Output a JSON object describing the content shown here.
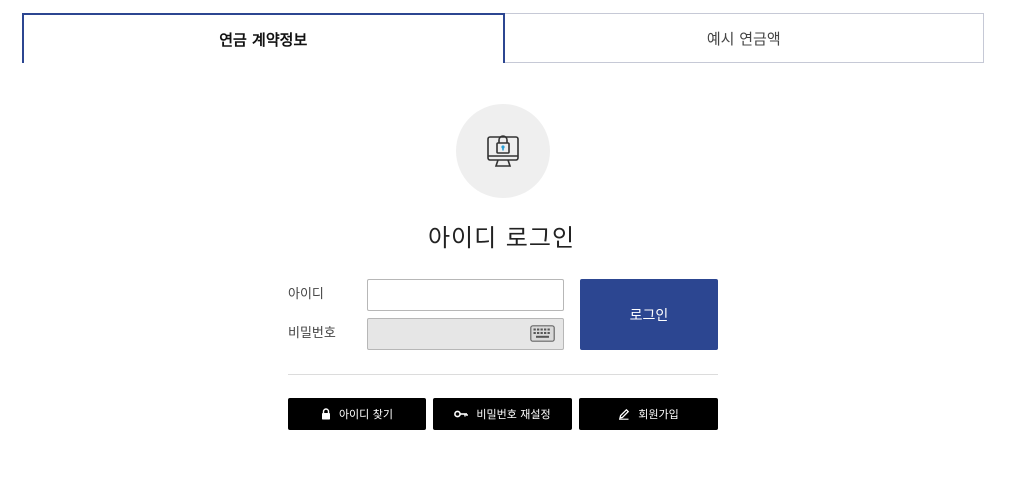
{
  "tabs": [
    {
      "label": "연금 계약정보",
      "active": true
    },
    {
      "label": "예시 연금액",
      "active": false
    }
  ],
  "login": {
    "title": "아이디 로그인",
    "id_label": "아이디",
    "password_label": "비밀번호",
    "id_value": "",
    "password_value": "",
    "submit_label": "로그인"
  },
  "actions": {
    "find_id": "아이디 찾기",
    "reset_password": "비밀번호 재설정",
    "signup": "회원가입"
  },
  "icons": {
    "hero": "monitor-lock-icon",
    "keyboard": "keyboard-icon",
    "find_id": "lock-icon",
    "reset_password": "key-icon",
    "signup": "pencil-icon"
  },
  "colors": {
    "primary": "#2c4691",
    "action_button": "#000000",
    "disabled_input": "#e6e6e6",
    "icon_accent": "#2a9fd6"
  }
}
